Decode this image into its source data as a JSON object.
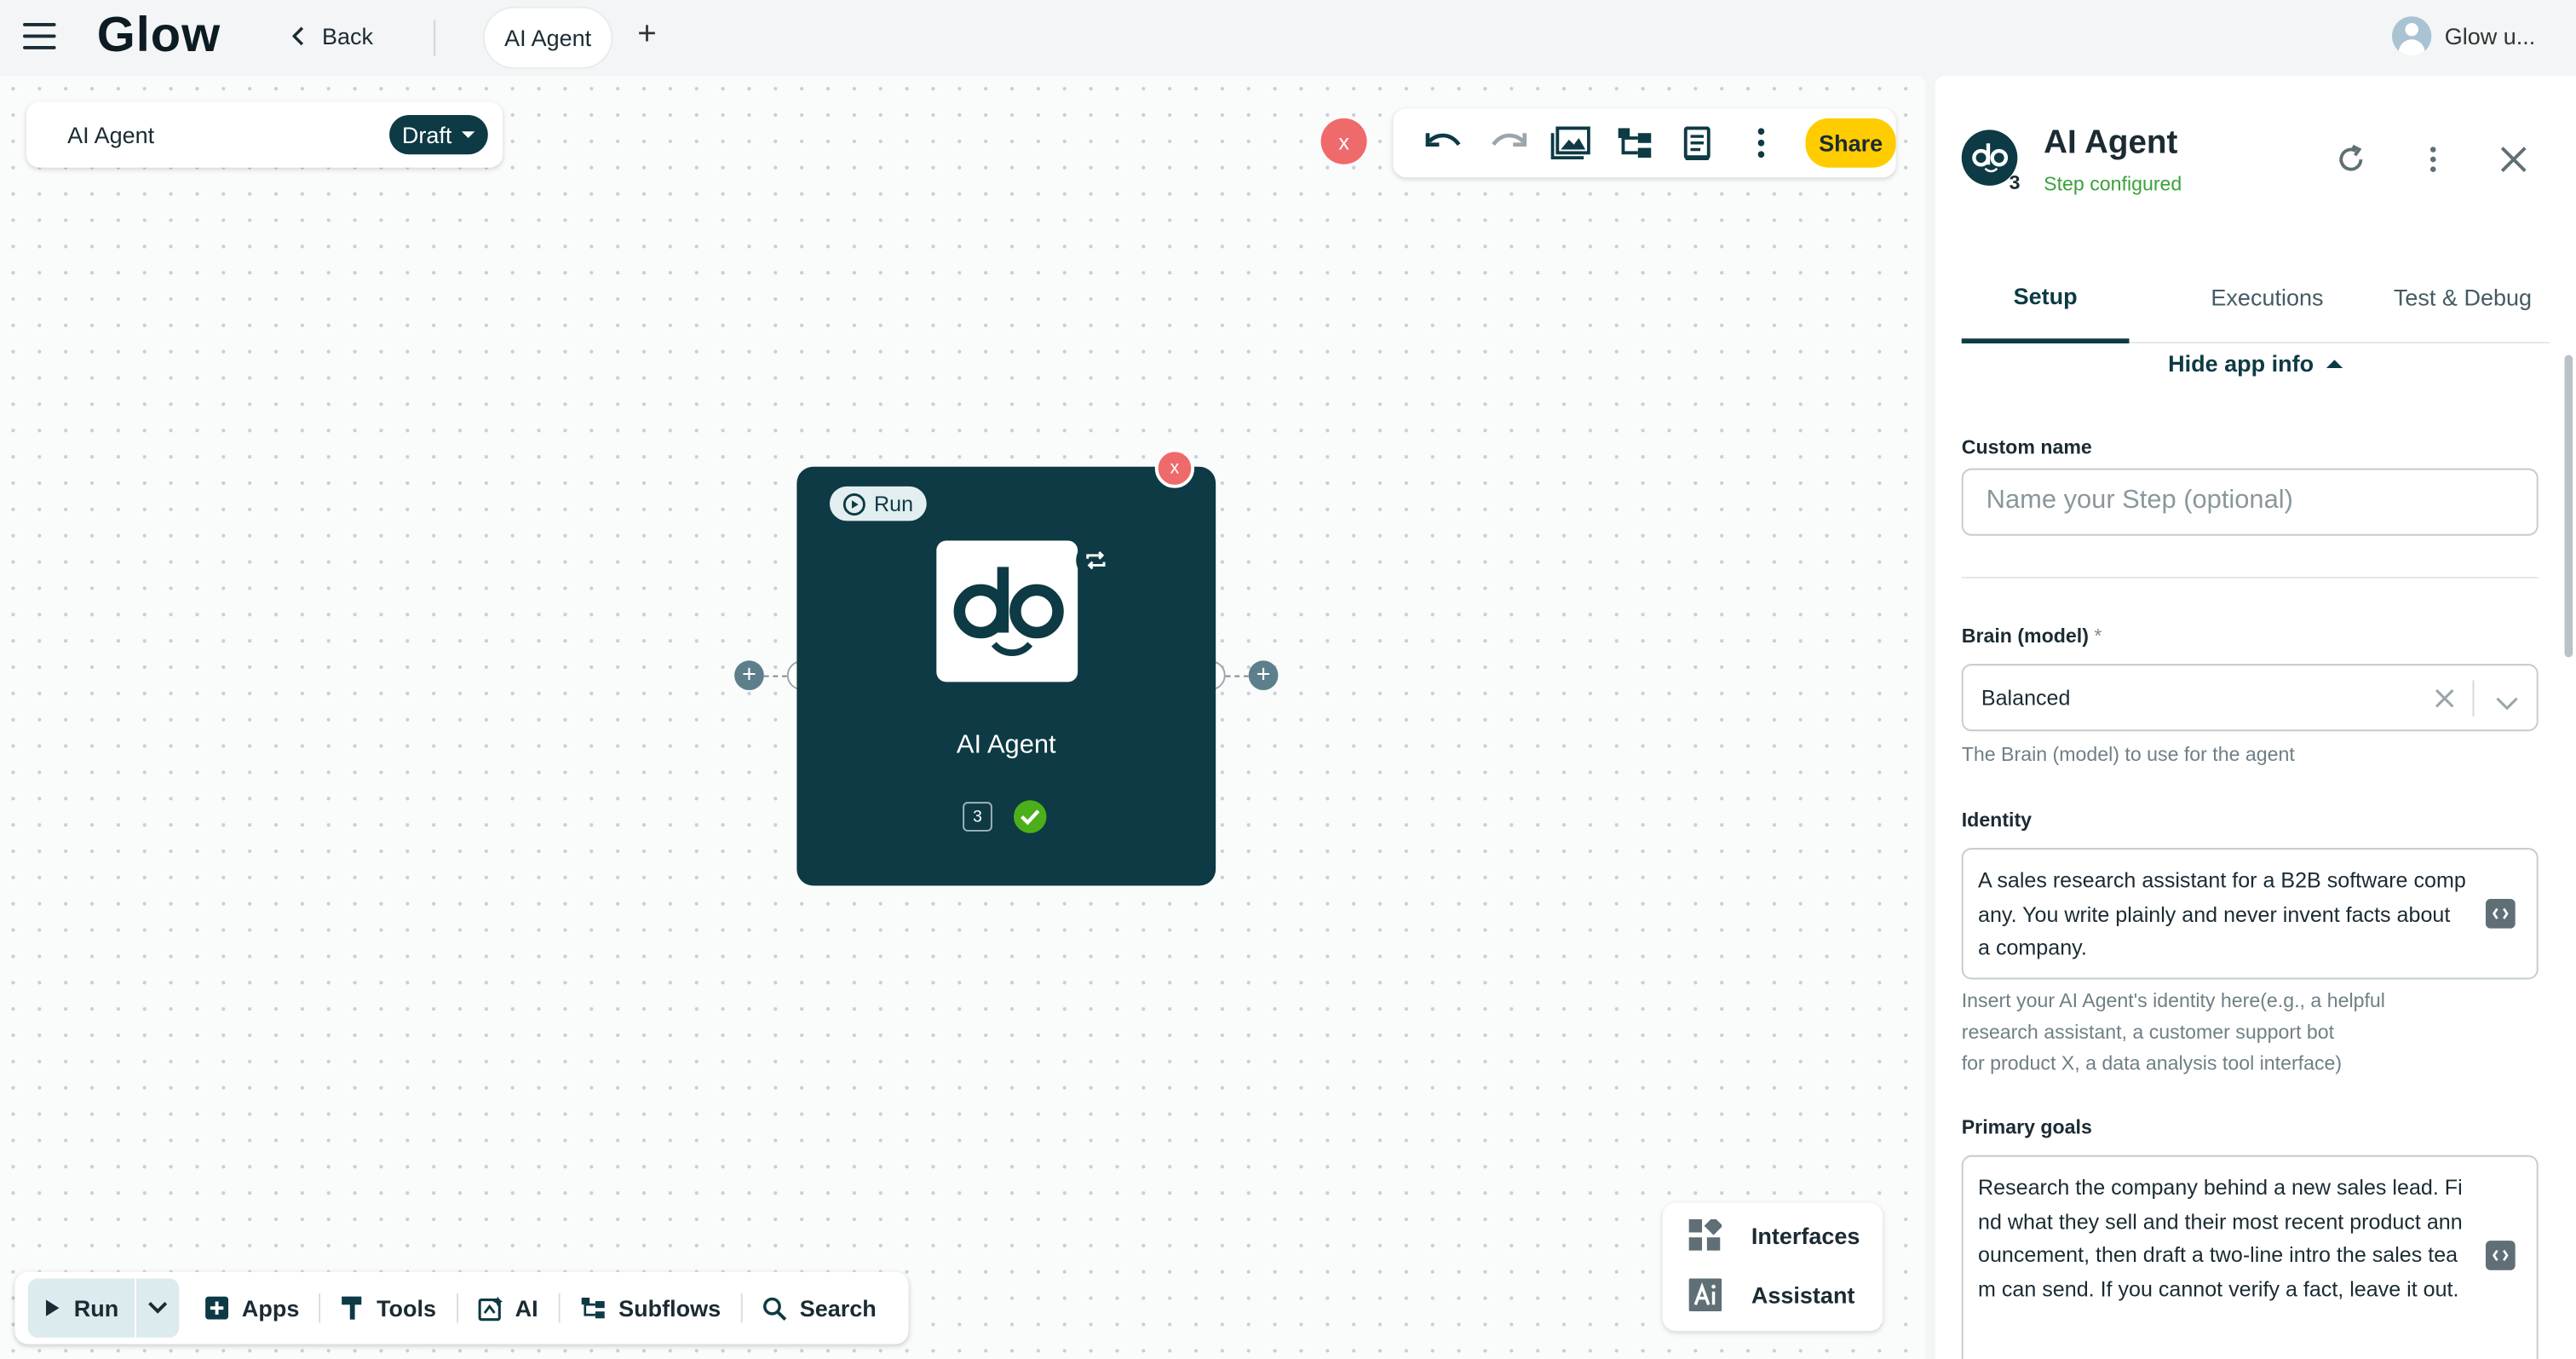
{
  "app": {
    "logo": "Glow",
    "back_label": "Back",
    "tab_label": "AI Agent",
    "add_tab": "+",
    "user_label": "Glow u..."
  },
  "flow": {
    "name": "AI Agent",
    "status": "Draft"
  },
  "toolbar": {
    "close": "x",
    "share_label": "Share",
    "icons": [
      "undo-icon",
      "redo-icon",
      "image-icon",
      "hierarchy-icon",
      "notes-icon",
      "more-vertical-icon"
    ]
  },
  "node": {
    "run_label": "Run",
    "title": "AI Agent",
    "step_number": "3",
    "close": "x"
  },
  "bottom_bar": {
    "run_label": "Run",
    "items": [
      "Apps",
      "Tools",
      "AI",
      "Subflows",
      "Search"
    ]
  },
  "float_panel": {
    "interfaces_label": "Interfaces",
    "assistant_label": "Assistant"
  },
  "panel": {
    "title": "AI Agent",
    "step_count": "3",
    "status": "Step configured",
    "tabs": [
      "Setup",
      "Executions",
      "Test & Debug"
    ],
    "active_tab": "Setup",
    "hide_info_label": "Hide app info",
    "custom_name": {
      "label": "Custom name",
      "placeholder": "Name your Step (optional)"
    },
    "brain": {
      "label": "Brain (model)",
      "required_mark": "*",
      "value": "Balanced",
      "help": "The Brain (model) to use for the agent"
    },
    "identity": {
      "label": "Identity",
      "value": "A sales research assistant for a B2B software company. You write plainly and never invent facts about a company.",
      "help_lines": [
        "Insert your AI Agent's identity here(e.g., a helpful",
        "research assistant, a customer support bot",
        "for product X, a data analysis tool interface)"
      ]
    },
    "goals": {
      "label": "Primary goals",
      "value": "Research the company behind a new sales lead. Find what they sell and their most recent product announcement, then draft a two-line intro the sales team can send. If you cannot verify a fact, leave it out."
    }
  },
  "colors": {
    "brand_dark": "#0d3a44",
    "share_yellow": "#ffcc00",
    "close_red": "#ef6a6a",
    "success_green": "#3aa13a"
  }
}
